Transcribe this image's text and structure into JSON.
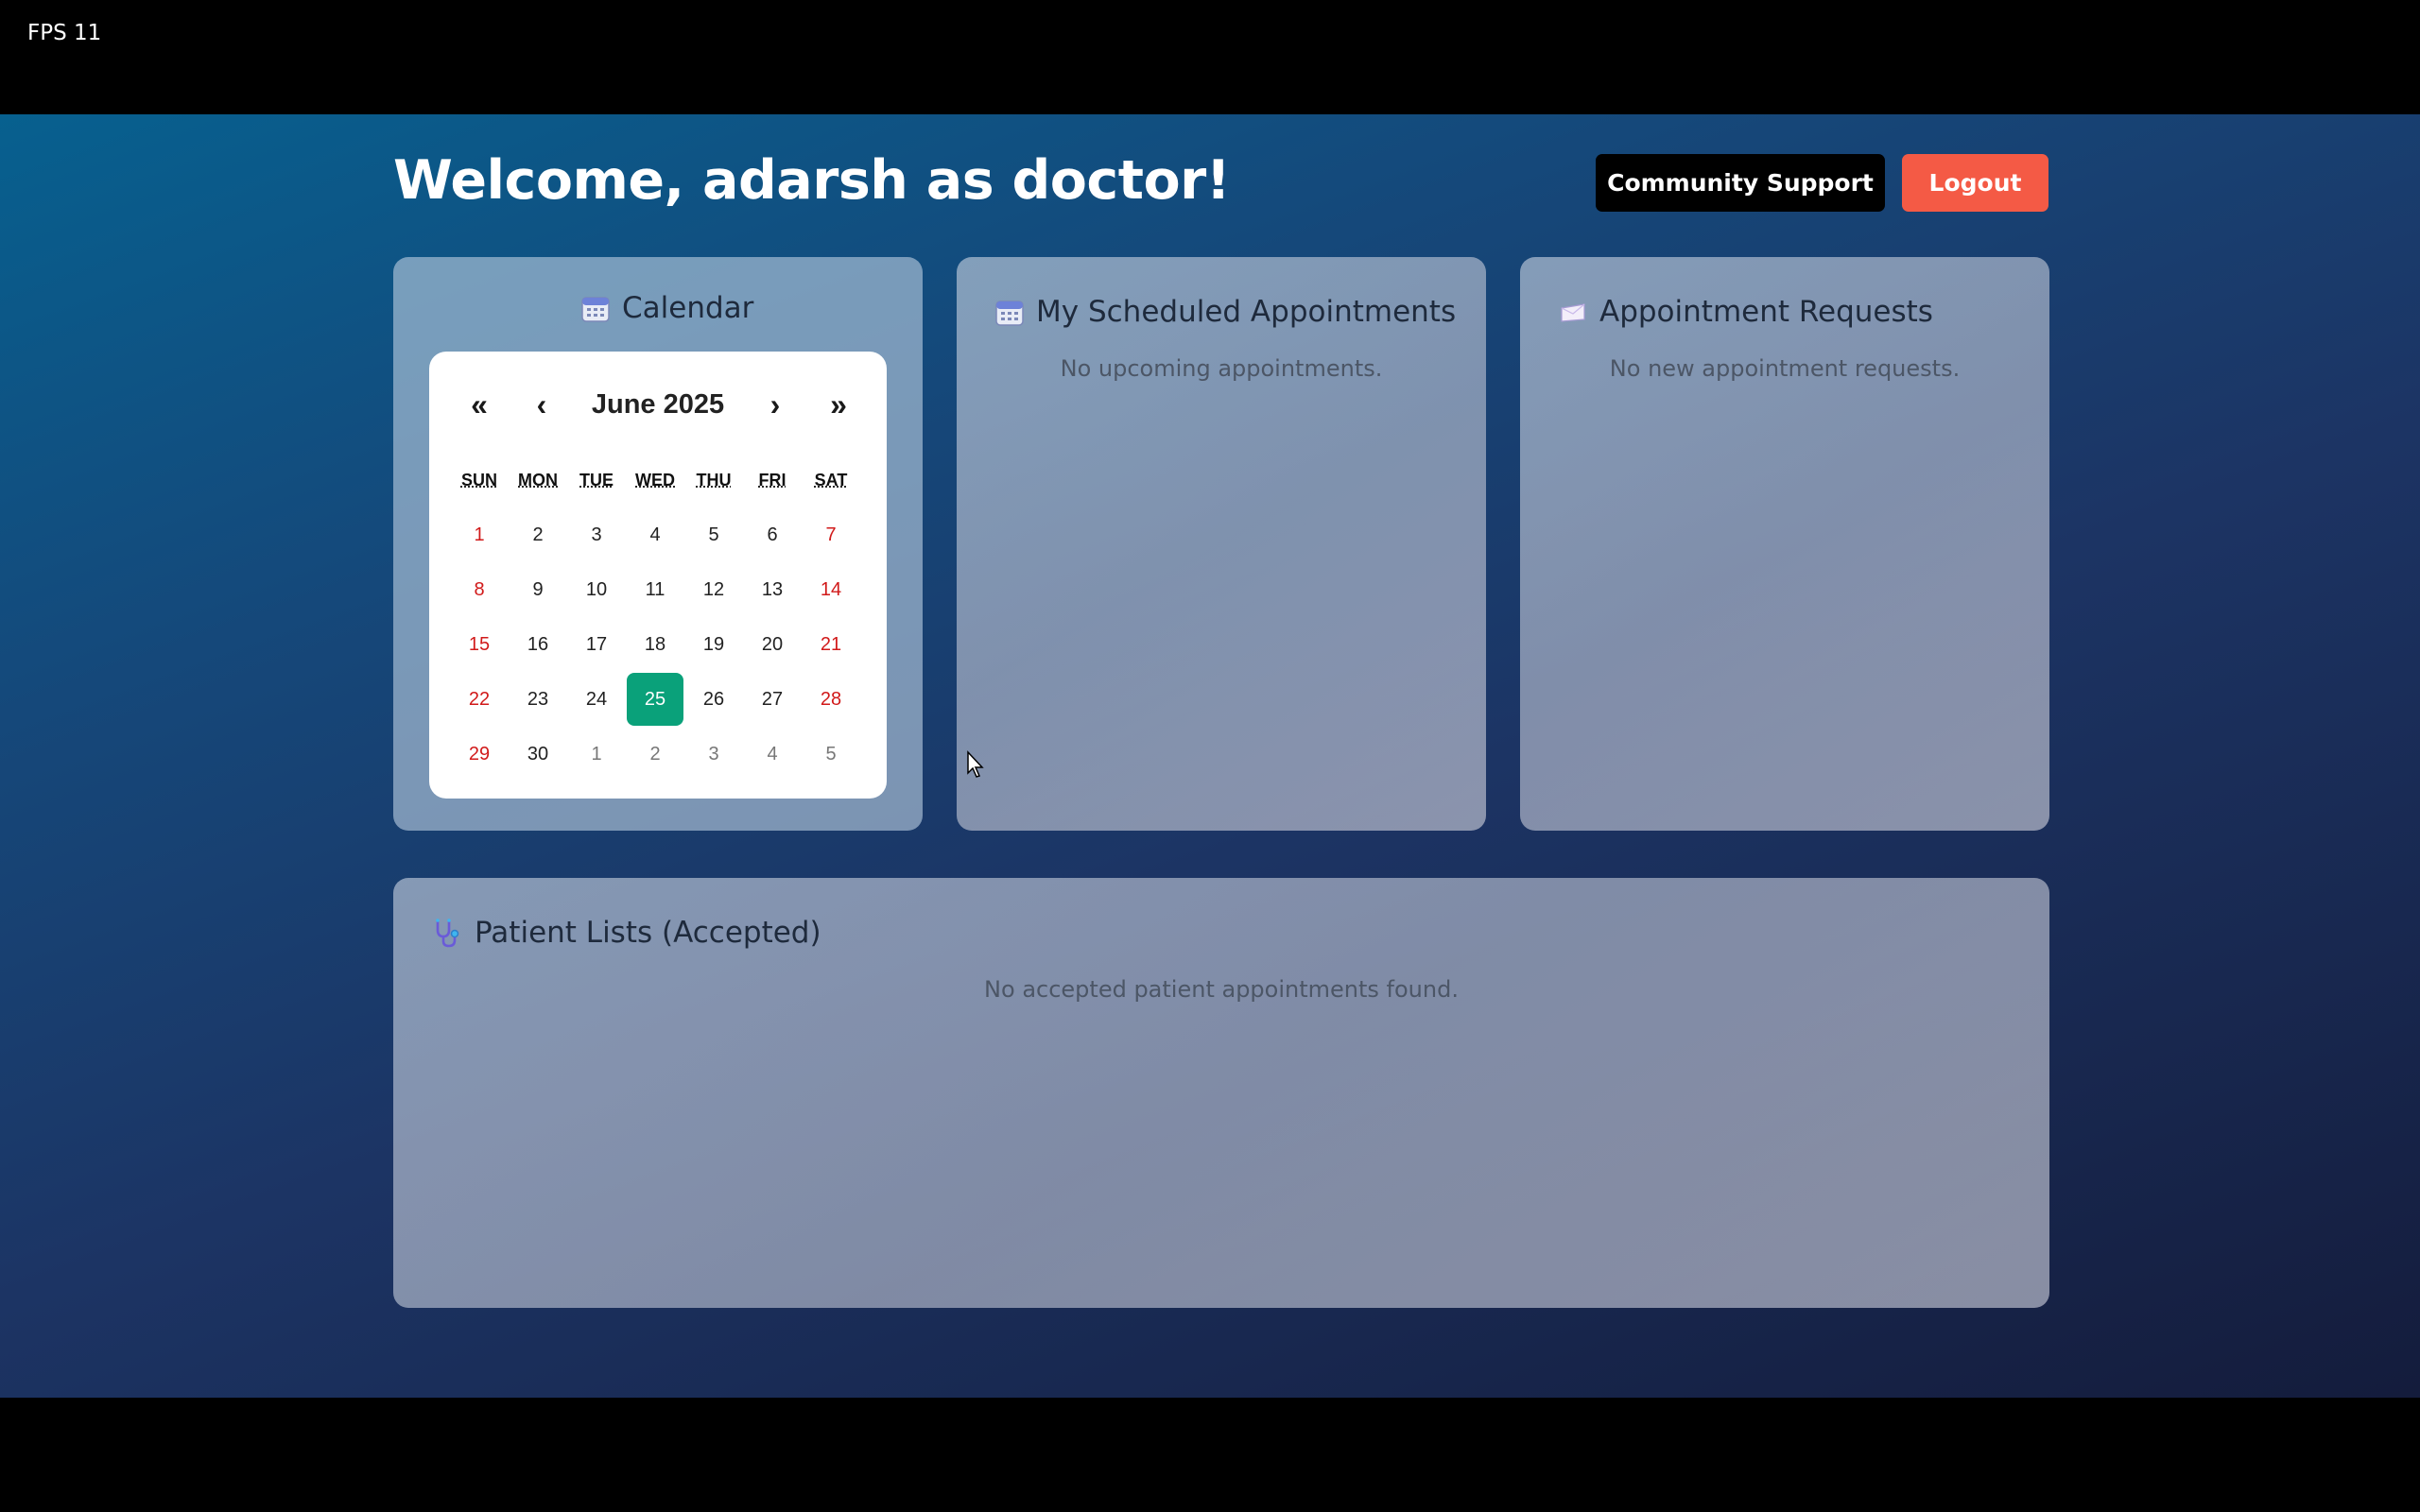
{
  "overlay": {
    "fps": "FPS 11"
  },
  "header": {
    "welcome": "Welcome, adarsh as doctor!",
    "community_label": "Community Support",
    "logout_label": "Logout"
  },
  "calendar_card": {
    "title": "Calendar",
    "icon": "calendar-icon",
    "nav": {
      "prev_year": "«",
      "prev_month": "‹",
      "next_month": "›",
      "next_year": "»"
    },
    "month_label": "June 2025",
    "weekdays": [
      "SUN",
      "MON",
      "TUE",
      "WED",
      "THU",
      "FRI",
      "SAT"
    ],
    "weeks": [
      [
        "1",
        "2",
        "3",
        "4",
        "5",
        "6",
        "7"
      ],
      [
        "8",
        "9",
        "10",
        "11",
        "12",
        "13",
        "14"
      ],
      [
        "15",
        "16",
        "17",
        "18",
        "19",
        "20",
        "21"
      ],
      [
        "22",
        "23",
        "24",
        "25",
        "26",
        "27",
        "28"
      ],
      [
        "29",
        "30",
        "1",
        "2",
        "3",
        "4",
        "5"
      ]
    ],
    "selected_day": "25",
    "colors": {
      "weekend": "#d11a1a",
      "selected_bg": "#0aa17a"
    }
  },
  "scheduled": {
    "title": "My Scheduled Appointments",
    "icon": "calendar-icon",
    "empty": "No upcoming appointments."
  },
  "requests": {
    "title": "Appointment Requests",
    "icon": "envelope-icon",
    "empty": "No new appointment requests."
  },
  "patients": {
    "title": "Patient Lists (Accepted)",
    "icon": "stethoscope-icon",
    "empty": "No accepted patient appointments found."
  },
  "colors": {
    "logout": "#f45a45",
    "community": "#000000"
  }
}
